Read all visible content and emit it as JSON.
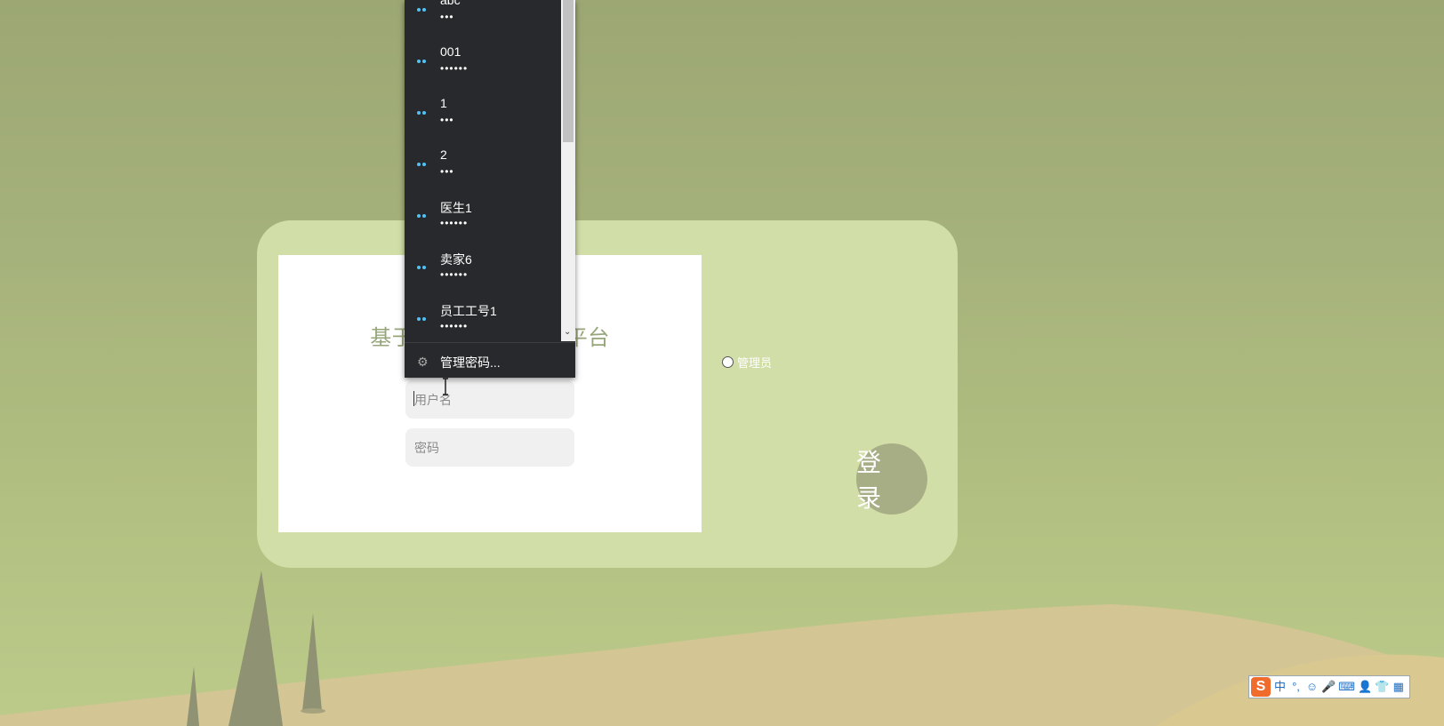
{
  "login_card": {
    "title": "基于协同过滤的电商平台",
    "username_placeholder": "用户名",
    "password_placeholder": "密码",
    "role_option": "管理员",
    "login_button": "登 录"
  },
  "password_dropdown": {
    "items": [
      {
        "username": "abc",
        "password_mask": "•••"
      },
      {
        "username": "001",
        "password_mask": "••••••"
      },
      {
        "username": "1",
        "password_mask": "•••"
      },
      {
        "username": "2",
        "password_mask": "•••"
      },
      {
        "username": "医生1",
        "password_mask": "••••••"
      },
      {
        "username": "卖家6",
        "password_mask": "••••••"
      },
      {
        "username": "员工工号1",
        "password_mask": "••••••"
      }
    ],
    "manage_label": "管理密码..."
  },
  "ime_toolbar": {
    "logo": "S",
    "items": [
      "中",
      "°,",
      "☺",
      "🎤",
      "⌨",
      "👤",
      "👕",
      "▦"
    ]
  },
  "colors": {
    "card_bg": "#d1dea7",
    "title": "#97a67a",
    "login_button_bg": "#a7ae85",
    "dropdown_bg": "#28292c",
    "key_icon": "#4fc3f7"
  }
}
